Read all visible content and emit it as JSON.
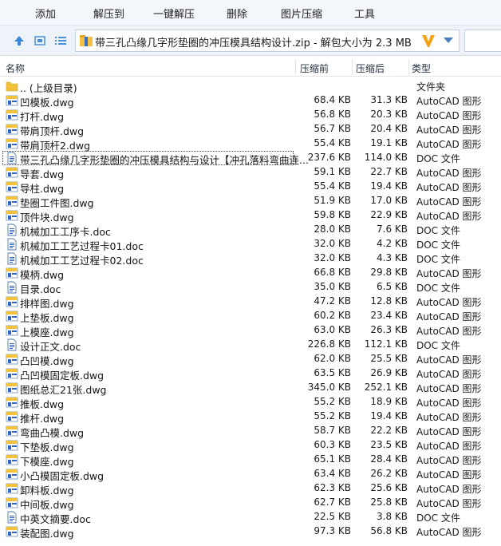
{
  "toolbar": {
    "add": "添加",
    "extract_to": "解压到",
    "one_click_extract": "一键解压",
    "delete": "删除",
    "image_compress": "图片压缩",
    "tools": "工具"
  },
  "address": {
    "path": "带三孔凸缘几字形垫圈的冲压模具结构设计.zip - 解包大小为 2.3 MB"
  },
  "columns": {
    "name": "名称",
    "size": "压缩前",
    "compressed": "压缩后",
    "type": "类型"
  },
  "rows": [
    {
      "name": ".. (上级目录)",
      "size": "",
      "compressed": "",
      "type": "文件夹",
      "icon": "folder-icon"
    },
    {
      "name": "凹模板.dwg",
      "size": "68.4 KB",
      "compressed": "31.3 KB",
      "type": "AutoCAD 图形",
      "icon": "dwg-icon"
    },
    {
      "name": "打杆.dwg",
      "size": "56.8 KB",
      "compressed": "20.3 KB",
      "type": "AutoCAD 图形",
      "icon": "dwg-icon"
    },
    {
      "name": "带肩顶杆.dwg",
      "size": "56.7 KB",
      "compressed": "20.4 KB",
      "type": "AutoCAD 图形",
      "icon": "dwg-icon"
    },
    {
      "name": "带肩顶杆2.dwg",
      "size": "55.4 KB",
      "compressed": "19.1 KB",
      "type": "AutoCAD 图形",
      "icon": "dwg-icon"
    },
    {
      "name": "带三孔凸缘几字形垫圈的冲压模具结构与设计【冲孔落料弯曲连...",
      "size": "237.6 KB",
      "compressed": "114.0 KB",
      "type": "DOC 文件",
      "icon": "doc-icon",
      "selected": true
    },
    {
      "name": "导套.dwg",
      "size": "59.1 KB",
      "compressed": "22.7 KB",
      "type": "AutoCAD 图形",
      "icon": "dwg-icon"
    },
    {
      "name": "导柱.dwg",
      "size": "55.4 KB",
      "compressed": "19.4 KB",
      "type": "AutoCAD 图形",
      "icon": "dwg-icon"
    },
    {
      "name": "垫圈工件图.dwg",
      "size": "51.9 KB",
      "compressed": "17.0 KB",
      "type": "AutoCAD 图形",
      "icon": "dwg-icon"
    },
    {
      "name": "顶件块.dwg",
      "size": "59.8 KB",
      "compressed": "22.9 KB",
      "type": "AutoCAD 图形",
      "icon": "dwg-icon"
    },
    {
      "name": "机械加工工序卡.doc",
      "size": "28.0 KB",
      "compressed": "7.6 KB",
      "type": "DOC 文件",
      "icon": "doc-icon"
    },
    {
      "name": "机械加工工艺过程卡01.doc",
      "size": "32.0 KB",
      "compressed": "4.2 KB",
      "type": "DOC 文件",
      "icon": "doc-icon"
    },
    {
      "name": "机械加工工艺过程卡02.doc",
      "size": "32.0 KB",
      "compressed": "4.3 KB",
      "type": "DOC 文件",
      "icon": "doc-icon"
    },
    {
      "name": "模柄.dwg",
      "size": "66.8 KB",
      "compressed": "29.8 KB",
      "type": "AutoCAD 图形",
      "icon": "dwg-icon"
    },
    {
      "name": "目录.doc",
      "size": "35.0 KB",
      "compressed": "6.5 KB",
      "type": "DOC 文件",
      "icon": "doc-icon"
    },
    {
      "name": "排样图.dwg",
      "size": "47.2 KB",
      "compressed": "12.8 KB",
      "type": "AutoCAD 图形",
      "icon": "dwg-icon"
    },
    {
      "name": "上垫板.dwg",
      "size": "60.2 KB",
      "compressed": "23.4 KB",
      "type": "AutoCAD 图形",
      "icon": "dwg-icon"
    },
    {
      "name": "上模座.dwg",
      "size": "63.0 KB",
      "compressed": "26.3 KB",
      "type": "AutoCAD 图形",
      "icon": "dwg-icon"
    },
    {
      "name": "设计正文.doc",
      "size": "226.8 KB",
      "compressed": "112.1 KB",
      "type": "DOC 文件",
      "icon": "doc-icon"
    },
    {
      "name": "凸凹模.dwg",
      "size": "62.0 KB",
      "compressed": "25.5 KB",
      "type": "AutoCAD 图形",
      "icon": "dwg-icon"
    },
    {
      "name": "凸凹模固定板.dwg",
      "size": "63.5 KB",
      "compressed": "26.9 KB",
      "type": "AutoCAD 图形",
      "icon": "dwg-icon"
    },
    {
      "name": "图纸总汇21张.dwg",
      "size": "345.0 KB",
      "compressed": "252.1 KB",
      "type": "AutoCAD 图形",
      "icon": "dwg-icon"
    },
    {
      "name": "推板.dwg",
      "size": "55.2 KB",
      "compressed": "18.9 KB",
      "type": "AutoCAD 图形",
      "icon": "dwg-icon"
    },
    {
      "name": "推杆.dwg",
      "size": "55.2 KB",
      "compressed": "19.4 KB",
      "type": "AutoCAD 图形",
      "icon": "dwg-icon"
    },
    {
      "name": "弯曲凸模.dwg",
      "size": "58.7 KB",
      "compressed": "22.2 KB",
      "type": "AutoCAD 图形",
      "icon": "dwg-icon"
    },
    {
      "name": "下垫板.dwg",
      "size": "60.3 KB",
      "compressed": "23.5 KB",
      "type": "AutoCAD 图形",
      "icon": "dwg-icon"
    },
    {
      "name": "下模座.dwg",
      "size": "65.1 KB",
      "compressed": "28.4 KB",
      "type": "AutoCAD 图形",
      "icon": "dwg-icon"
    },
    {
      "name": "小凸模固定板.dwg",
      "size": "63.4 KB",
      "compressed": "26.2 KB",
      "type": "AutoCAD 图形",
      "icon": "dwg-icon"
    },
    {
      "name": "卸料板.dwg",
      "size": "62.3 KB",
      "compressed": "25.6 KB",
      "type": "AutoCAD 图形",
      "icon": "dwg-icon"
    },
    {
      "name": "中间板.dwg",
      "size": "62.7 KB",
      "compressed": "25.8 KB",
      "type": "AutoCAD 图形",
      "icon": "dwg-icon"
    },
    {
      "name": "中英文摘要.doc",
      "size": "22.5 KB",
      "compressed": "3.8 KB",
      "type": "DOC 文件",
      "icon": "doc-icon"
    },
    {
      "name": "装配图.dwg",
      "size": "97.3 KB",
      "compressed": "56.8 KB",
      "type": "AutoCAD 图形",
      "icon": "dwg-icon"
    }
  ]
}
